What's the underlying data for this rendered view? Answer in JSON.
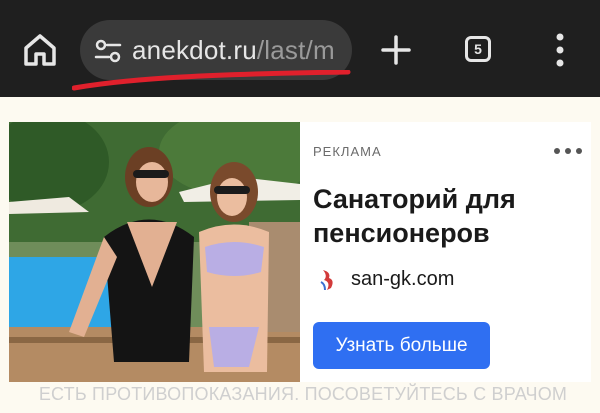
{
  "browser": {
    "url_domain": "anekdot.ru",
    "url_path": "/last/m",
    "tab_count": "5",
    "icons": {
      "home": "home-icon",
      "site_info": "tune-icon",
      "new_tab": "plus-icon",
      "menu": "more-vert-icon"
    },
    "underline_color": "#e0202c"
  },
  "ad": {
    "label": "РЕКЛАМА",
    "headline": "Санаторий для пенсионеров",
    "domain": "san-gk.com",
    "cta": "Узнать больше",
    "disclaimer": "ЕСТЬ ПРОТИВОПОКАЗАНИЯ. ПОСОВЕТУЙТЕСЬ С ВРАЧОМ",
    "cta_color": "#2f6ff2"
  }
}
